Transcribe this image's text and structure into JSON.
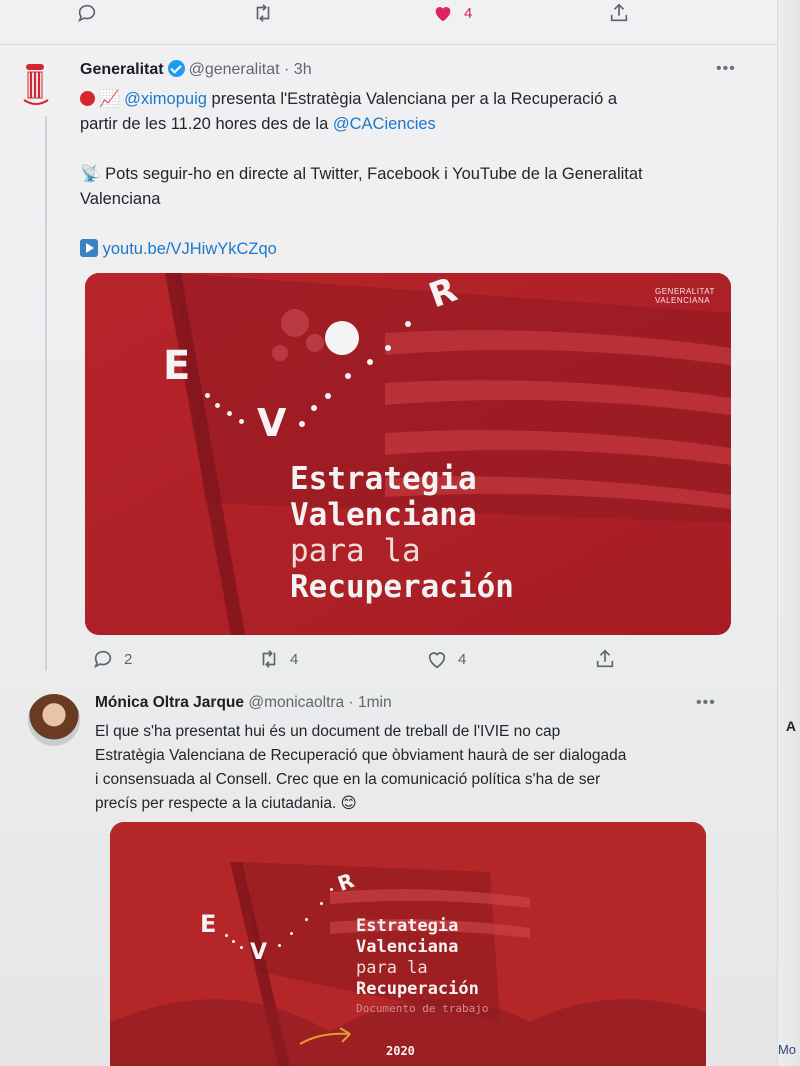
{
  "top_actions": {
    "reply_count": "",
    "retweet_count": "",
    "like_count": "4"
  },
  "tweet1": {
    "name": "Generalitat",
    "handle": "@generalitat",
    "time": "· 3h",
    "mention": "@ximopuig",
    "line1_rest": " presenta l'Estratègia Valenciana per a la Recuperació a",
    "line2": "partir de les 11.20 hores des de la ",
    "mention2": "@CACiencies",
    "line3": "Pots seguir-ho en directe al Twitter, Facebook i YouTube de la Generalitat",
    "line4": "Valenciana",
    "link": "youtu.be/VJHiwYkCZqo",
    "replies": "2",
    "retweets": "4",
    "likes": "4",
    "card": {
      "logo_line1": "GENERALITAT",
      "logo_line2": "VALENCIANA",
      "letter_e": "E",
      "letter_v": "V",
      "letter_r": "R",
      "title1": "Estrategia",
      "title2": "Valenciana",
      "title3": "para la",
      "title4": "Recuperación"
    }
  },
  "tweet2": {
    "name": "Mónica Oltra Jarque",
    "handle": "@monicaoltra",
    "time": "· 1min",
    "line1": "El que s'ha presentat hui és un document de treball de l'IVIE no cap",
    "line2": "Estratègia Valenciana de Recuperació que òbviament haurà de ser dialogada",
    "line3": "i consensuada al Consell. Crec que en la comunicació política s'ha de ser",
    "line4": "precís per respecte a la ciutadania. 😊",
    "card": {
      "letter_e": "E",
      "letter_v": "V",
      "letter_r": "R",
      "title1": "Estrategia",
      "title2": "Valenciana",
      "title3": "para la",
      "title4": "Recuperación",
      "subtitle": "Documento de trabajo",
      "year": "2020"
    }
  },
  "edge": {
    "glyph1": "A",
    "glyph2": "Mo"
  }
}
